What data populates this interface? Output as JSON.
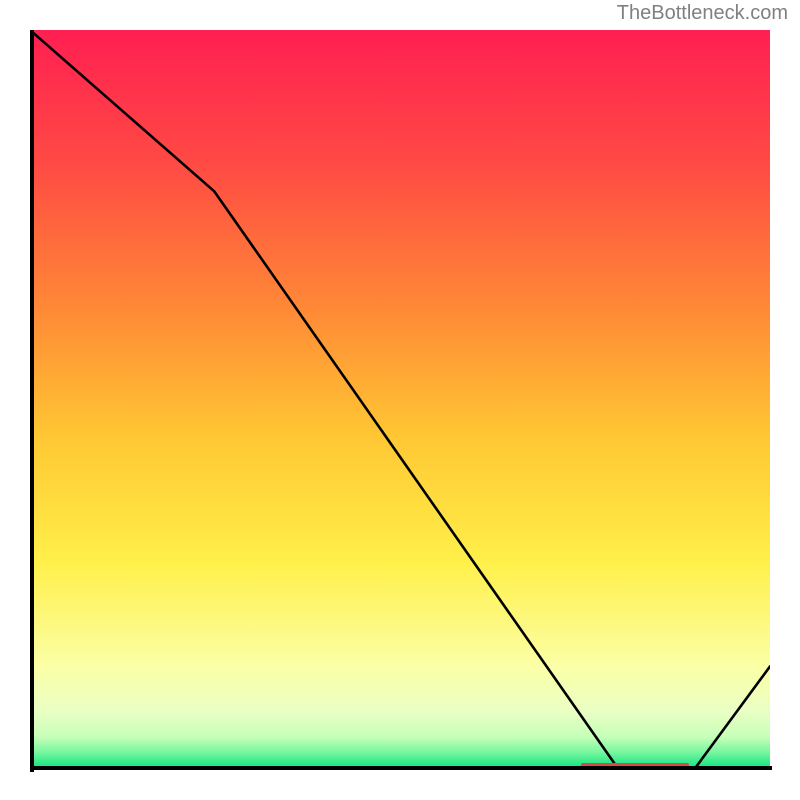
{
  "watermark": "TheBottleneck.com",
  "colors": {
    "gradient_top": "#ff1f52",
    "gradient_mid_upper": "#ff6a3a",
    "gradient_mid": "#ffc733",
    "gradient_mid_lower": "#fff24d",
    "gradient_lower": "#f6ffc0",
    "gradient_bottom": "#00e37a",
    "line": "#000000",
    "axis": "#000000",
    "watermark": "#808080",
    "marker": "#d94a49"
  },
  "chart_data": {
    "type": "line",
    "title": "",
    "xlabel": "",
    "ylabel": "",
    "xlim": [
      0,
      100
    ],
    "ylim": [
      0,
      100
    ],
    "series": [
      {
        "name": "curve",
        "x": [
          0.0,
          24.9,
          79.6,
          89.7,
          100.0
        ],
        "values": [
          100.0,
          78.2,
          0.0,
          0.0,
          14.0
        ]
      }
    ],
    "annotations": [
      {
        "name": "optimal-zone-marker",
        "x_start": 74.5,
        "x_end": 89.0,
        "y": 0.6
      }
    ]
  }
}
